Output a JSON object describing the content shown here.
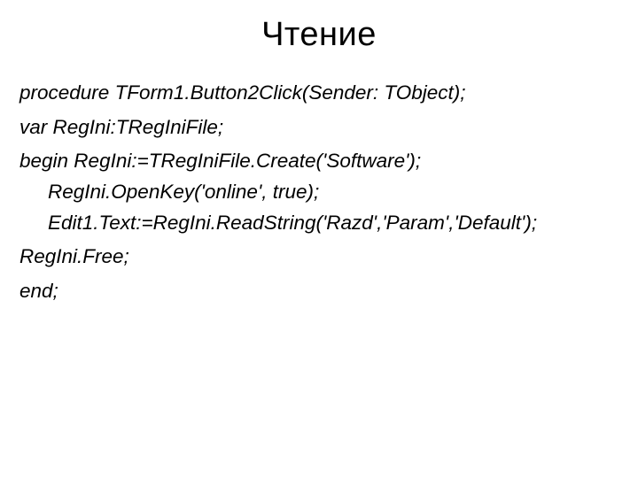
{
  "slide": {
    "title": "Чтение",
    "code": {
      "line1": "procedure TForm1.Button2Click(Sender: TObject);",
      "line2": "var RegIni:TRegIniFile;",
      "line3": "begin RegIni:=TRegIniFile.Create('Software');",
      "line4": "RegIni.OpenKey('online', true);",
      "line5": "Edit1.Text:=RegIni.ReadString('Razd','Param','Default');",
      "line6": "RegIni.Free;",
      "line7": "end;"
    }
  }
}
